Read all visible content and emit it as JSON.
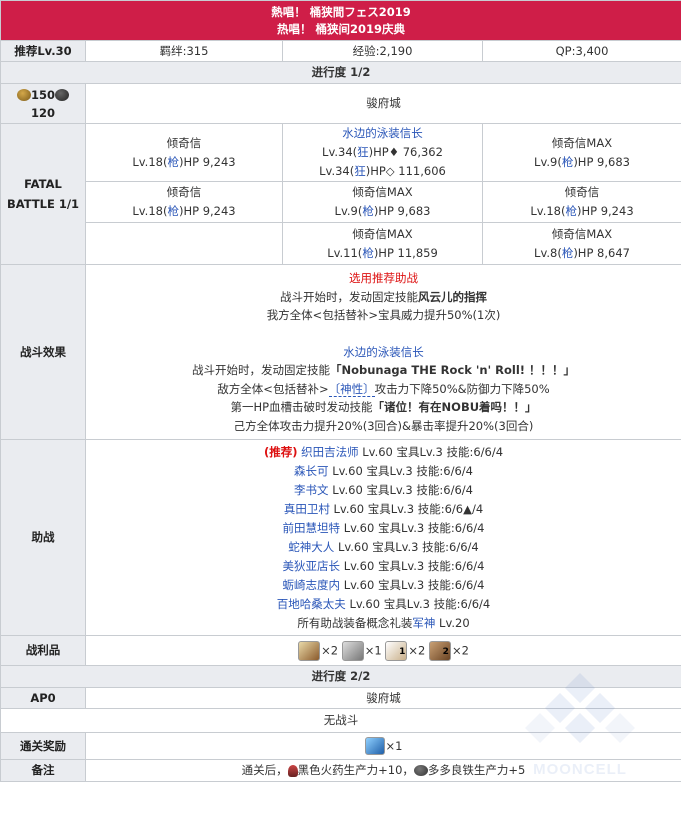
{
  "header": {
    "title_jp": "熱唱！ 桶狭間フェス2019",
    "title_cn": "热唱！ 桶狭间2019庆典"
  },
  "summary": {
    "rec_level": "推荐Lv.30",
    "bond": "羁绊:315",
    "exp": "经验:2,190",
    "qp": "QP:3,400"
  },
  "progress1": {
    "title": "进行度 1/2",
    "ap_top": "150",
    "ap_bottom": "120",
    "location": "骏府城",
    "battle_label": "FATAL BATTLE 1/1",
    "r1c1": {
      "name": "倾奇信",
      "pre": "Lv.18(",
      "cls": "枪",
      "post": ")HP 9,243"
    },
    "r1c2": {
      "name": "水边的泳装信长",
      "l1pre": "Lv.34(",
      "l1cls": "狂",
      "l1post": ")HP♦ 76,362",
      "l2pre": "Lv.34(",
      "l2cls": "狂",
      "l2post": ")HP◇ 111,606"
    },
    "r1c3": {
      "name": "倾奇信MAX",
      "pre": "Lv.9(",
      "cls": "枪",
      "post": ")HP 9,683"
    },
    "r2c1": {
      "name": "倾奇信",
      "pre": "Lv.18(",
      "cls": "枪",
      "post": ")HP 9,243"
    },
    "r2c2": {
      "name": "倾奇信MAX",
      "pre": "Lv.9(",
      "cls": "枪",
      "post": ")HP 9,683"
    },
    "r2c3": {
      "name": "倾奇信",
      "pre": "Lv.18(",
      "cls": "枪",
      "post": ")HP 9,243"
    },
    "r3c2": {
      "name": "倾奇信MAX",
      "pre": "Lv.11(",
      "cls": "枪",
      "post": ")HP 11,859"
    },
    "r3c3": {
      "name": "倾奇信MAX",
      "pre": "Lv.8(",
      "cls": "枪",
      "post": ")HP 8,647"
    },
    "effect_label": "战斗效果",
    "effect": {
      "support_head": "选用推荐助战",
      "s1a": "战斗开始时，发动固定技能",
      "s1b": "风云儿的指挥",
      "s2": "我方全体<包括替补>宝具威力提升50%(1次)",
      "boss_head": "水边的泳装信长",
      "b1a": "战斗开始时，发动固定技能",
      "b1b": "「Nobunaga THE Rock 'n' Roll! ！！！」",
      "b2a": "敌方全体<包括替补>",
      "b2b": "〔神性〕",
      "b2c": "攻击力下降50%&防御力下降50%",
      "b3a": "第一HP血槽击破时发动技能",
      "b3b": "「诸位！有在NOBU着吗！！」",
      "b4": "己方全体攻击力提升20%(3回合)&暴击率提升20%(3回合)"
    },
    "support_label": "助战",
    "support": {
      "rec_tag": "(推荐)",
      "list": [
        {
          "name": "织田吉法师",
          "info": "Lv.60 宝具Lv.3 技能:6/6/4"
        },
        {
          "name": "森长可",
          "info": "Lv.60 宝具Lv.3 技能:6/6/4"
        },
        {
          "name": "李书文",
          "info": "Lv.60 宝具Lv.3 技能:6/6/4"
        },
        {
          "name": "真田卫村",
          "info": "Lv.60 宝具Lv.3 技能:6/6▲/4"
        },
        {
          "name": "前田慧坦特",
          "info": "Lv.60 宝具Lv.3 技能:6/6/4"
        },
        {
          "name": "蛇神大人",
          "info": "Lv.60 宝具Lv.3 技能:6/6/4"
        },
        {
          "name": "美狄亚店长",
          "info": "Lv.60 宝具Lv.3 技能:6/6/4"
        },
        {
          "name": "蛎崎志度内",
          "info": "Lv.60 宝具Lv.3 技能:6/6/4"
        },
        {
          "name": "百地哈桑太夫",
          "info": "Lv.60 宝具Lv.3 技能:6/6/4"
        }
      ],
      "ce_a": "所有助战装备概念礼装",
      "ce_b": "军神",
      "ce_c": " Lv.20"
    },
    "loot_label": "战利品",
    "loot": [
      "×2",
      "×1",
      "×2",
      "×2"
    ],
    "loot_subs": [
      "1",
      "2"
    ]
  },
  "progress2": {
    "title": "进行度 2/2",
    "ap": "AP0",
    "location": "骏府城",
    "no_battle": "无战斗",
    "reward_label": "通关奖励",
    "reward": "×1",
    "note_label": "备注",
    "note_a": "通关后，",
    "note_b": "黑色火药生产力+10，",
    "note_c": "多多良铁生产力+5"
  },
  "watermark": "MOONCELL",
  "colors": {
    "header": "#cf1e48",
    "label_bg": "#eaecf0",
    "link": "#2a56b8",
    "red": "#dd1111"
  }
}
